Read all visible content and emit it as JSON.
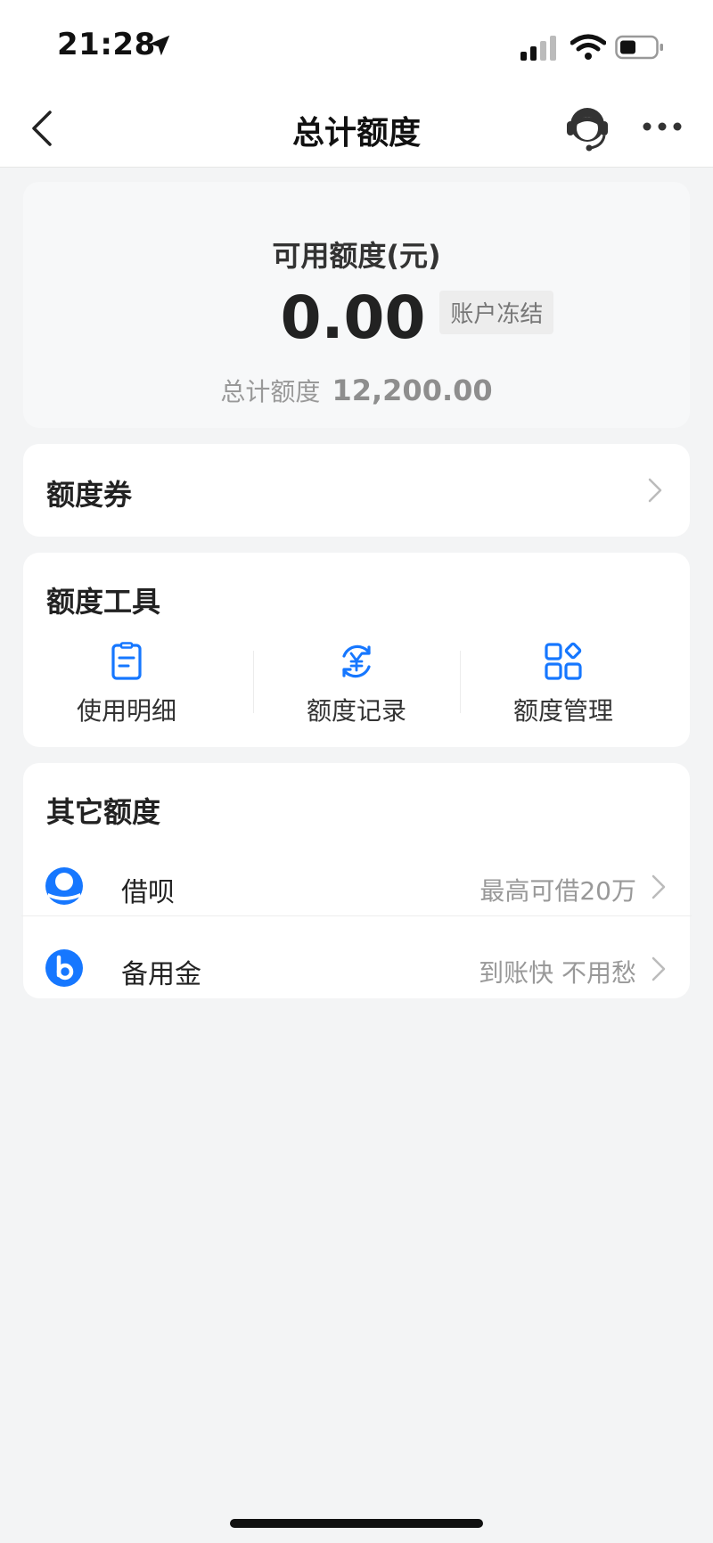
{
  "status_bar": {
    "time": "21:28"
  },
  "nav": {
    "title": "总计额度"
  },
  "balance": {
    "label": "可用额度(元)",
    "value": "0.00",
    "badge": "账户冻结",
    "total_label": "总计额度",
    "total_value": "12,200.00"
  },
  "coupon": {
    "title": "额度券"
  },
  "tools": {
    "title": "额度工具",
    "items": [
      {
        "label": "使用明细",
        "icon": "document-list-icon"
      },
      {
        "label": "额度记录",
        "icon": "yuan-cycle-icon"
      },
      {
        "label": "额度管理",
        "icon": "grid-manage-icon"
      }
    ]
  },
  "other": {
    "title": "其它额度",
    "items": [
      {
        "name": "借呗",
        "hint": "最高可借20万",
        "icon": "jiebei-icon"
      },
      {
        "name": "备用金",
        "hint": "到账快 不用愁",
        "icon": "beiyongjin-icon"
      }
    ]
  },
  "colors": {
    "accent": "#1677ff",
    "background": "#f3f4f5",
    "card": "#ffffff",
    "muted_text": "#999999"
  }
}
